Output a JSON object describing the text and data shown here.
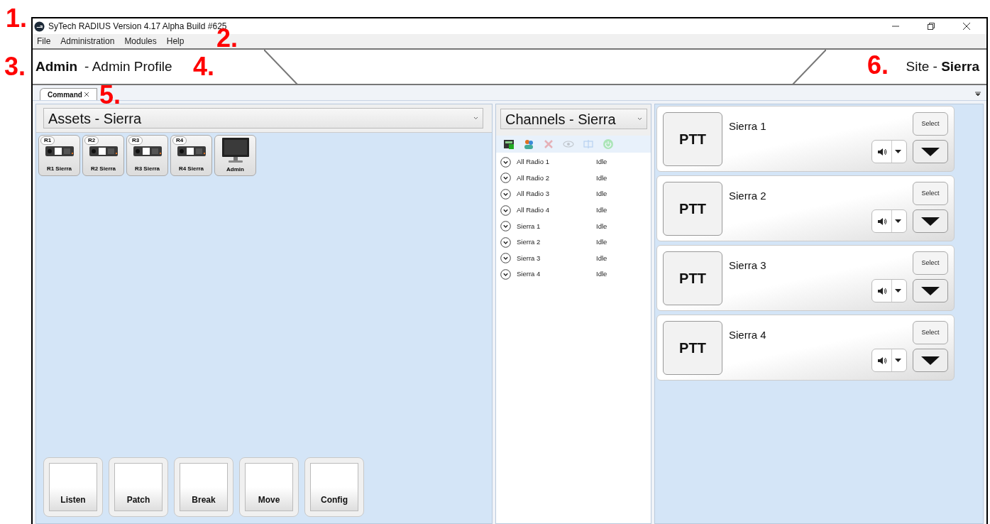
{
  "window": {
    "title": "SyTech RADIUS Version 4.17 Alpha Build #625"
  },
  "menu": [
    "File",
    "Administration",
    "Modules",
    "Help"
  ],
  "header": {
    "user": "Admin",
    "profile": "- Admin Profile",
    "site": "Site - **Sierra**"
  },
  "tabs": [
    {
      "label": "Command",
      "selected": true
    }
  ],
  "assets": {
    "dropdown": "Assets - Sierra",
    "items": [
      {
        "kind": "radio",
        "badge": "R1",
        "label": "R1 Sierra"
      },
      {
        "kind": "radio",
        "badge": "R2",
        "label": "R2 Sierra"
      },
      {
        "kind": "radio",
        "badge": "R3",
        "label": "R3 Sierra"
      },
      {
        "kind": "radio",
        "badge": "R4",
        "label": "R4 Sierra"
      },
      {
        "kind": "console",
        "label": "Admin"
      }
    ],
    "actions": [
      "Listen",
      "Patch",
      "Break",
      "Move",
      "Config"
    ]
  },
  "channels": {
    "dropdown": "Channels - Sierra",
    "toolbar": [
      {
        "kind": "add",
        "disabled": false
      },
      {
        "kind": "users",
        "disabled": false
      },
      {
        "kind": "delete",
        "disabled": true
      },
      {
        "kind": "view",
        "disabled": true
      },
      {
        "kind": "split",
        "disabled": true
      },
      {
        "kind": "power",
        "disabled": true
      }
    ],
    "rows": [
      {
        "name": "All Radio 1",
        "status": "Idle"
      },
      {
        "name": "All Radio 2",
        "status": "Idle"
      },
      {
        "name": "All Radio 3",
        "status": "Idle"
      },
      {
        "name": "All Radio 4",
        "status": "Idle"
      },
      {
        "name": "Sierra 1",
        "status": "Idle"
      },
      {
        "name": "Sierra 2",
        "status": "Idle"
      },
      {
        "name": "Sierra 3",
        "status": "Idle"
      },
      {
        "name": "Sierra 4",
        "status": "Idle"
      }
    ]
  },
  "cards": [
    {
      "ptt": "PTT",
      "name": "Sierra 1",
      "select": "Select"
    },
    {
      "ptt": "PTT",
      "name": "Sierra 2",
      "select": "Select"
    },
    {
      "ptt": "PTT",
      "name": "Sierra 3",
      "select": "Select"
    },
    {
      "ptt": "PTT",
      "name": "Sierra 4",
      "select": "Select"
    }
  ],
  "callouts": [
    "1.",
    "2.",
    "3.",
    "4.",
    "5.",
    "6."
  ]
}
